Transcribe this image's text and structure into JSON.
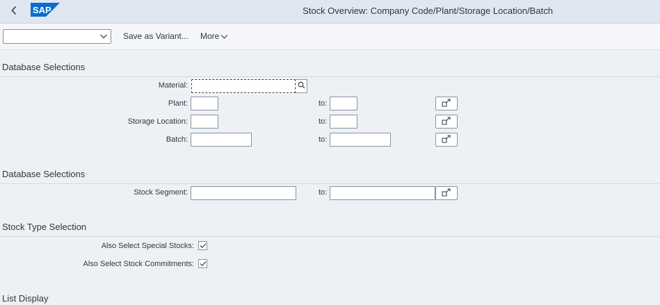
{
  "header": {
    "back_icon": "chevron-left-icon",
    "logo_text": "SAP",
    "brand_color": "#0a6ed1",
    "title": "Stock Overview: Company Code/Plant/Storage Location/Batch"
  },
  "toolbar": {
    "variant_value": "",
    "save_variant_label": "Save as Variant...",
    "more_label": "More"
  },
  "sections": {
    "db_selections_1": "Database Selections",
    "db_selections_2": "Database Selections",
    "stock_type": "Stock Type Selection",
    "list_display": "List Display"
  },
  "fields": {
    "material": {
      "label": "Material:",
      "value": ""
    },
    "plant": {
      "label": "Plant:",
      "from": "",
      "to_label": "to:",
      "to": ""
    },
    "storage_location": {
      "label": "Storage Location:",
      "from": "",
      "to_label": "to:",
      "to": ""
    },
    "batch": {
      "label": "Batch:",
      "from": "",
      "to_label": "to:",
      "to": ""
    },
    "stock_segment": {
      "label": "Stock Segment:",
      "from": "",
      "to_label": "to:",
      "to": ""
    }
  },
  "checkboxes": {
    "special_stocks": {
      "label": "Also Select Special Stocks:",
      "checked": true
    },
    "stock_commitments": {
      "label": "Also Select Stock Commitments:",
      "checked": true
    }
  }
}
